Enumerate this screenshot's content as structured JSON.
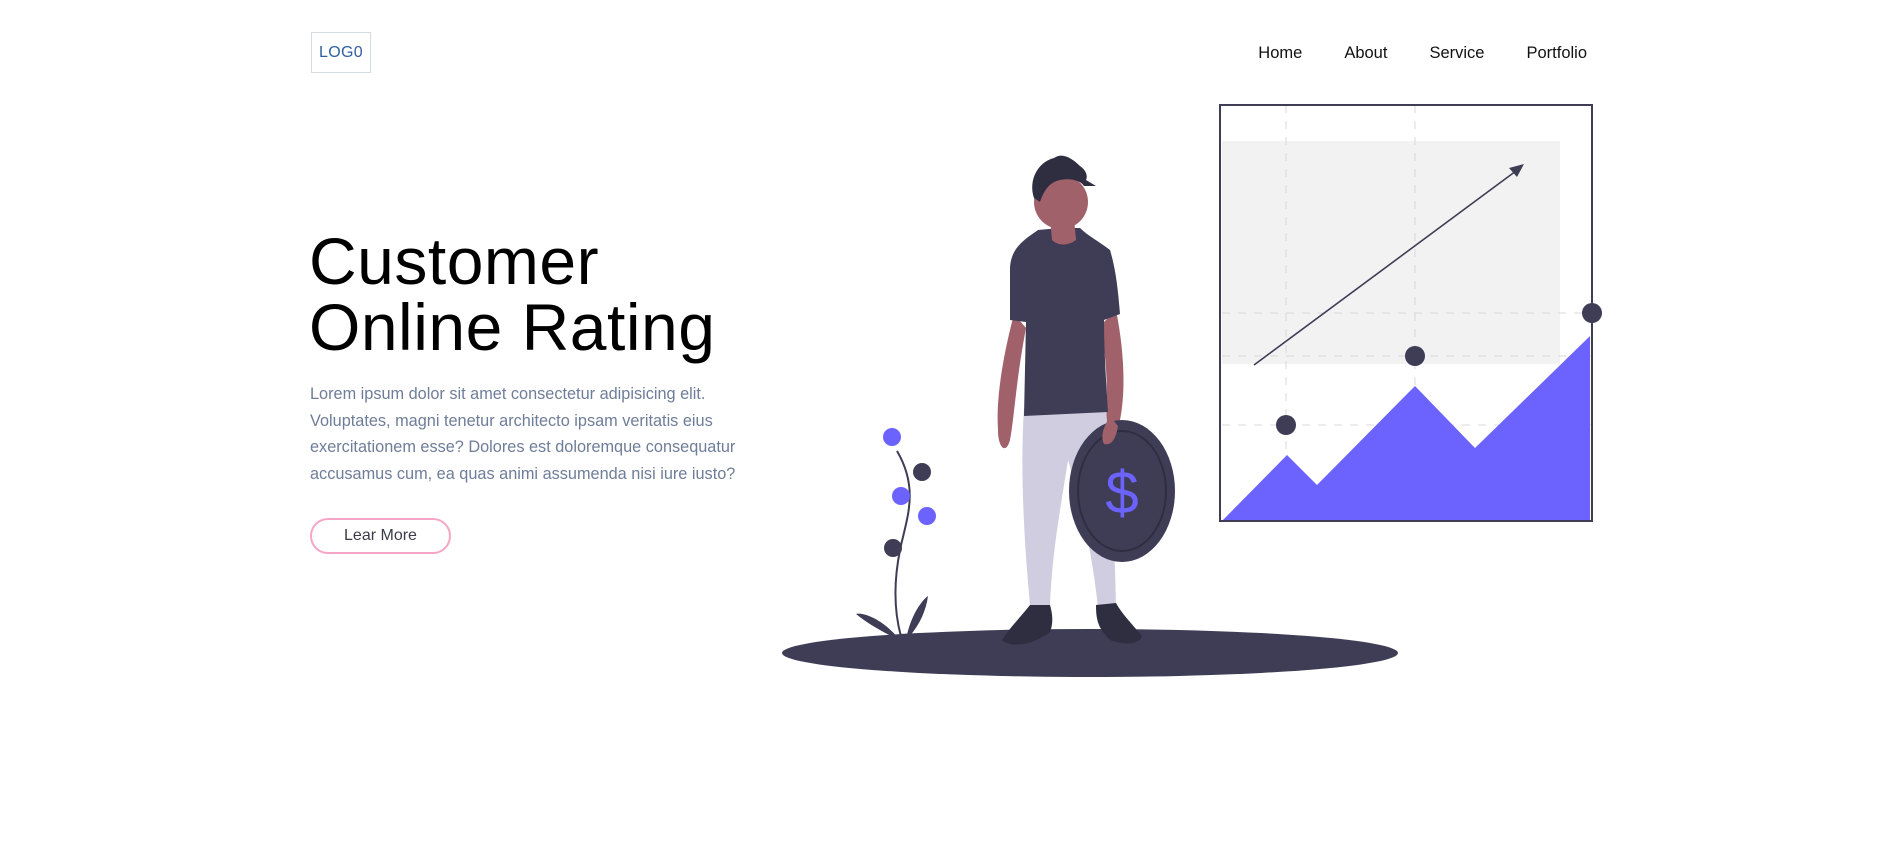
{
  "header": {
    "logo_text": "LOG0",
    "nav": [
      {
        "label": "Home"
      },
      {
        "label": "About"
      },
      {
        "label": "Service"
      },
      {
        "label": "Portfolio"
      }
    ]
  },
  "hero": {
    "title_line1": "Customer",
    "title_line2": "Online Rating",
    "description": "Lorem ipsum dolor sit amet consectetur adipisicing elit. Voluptates, magni tenetur architecto ipsam veritatis eius exercitationem esse? Dolores est doloremque consequatur accusamus cum, ea quas animi assumenda nisi iure iusto?",
    "button_label": "Lear More"
  },
  "illustration": {
    "coin_symbol": "$",
    "colors": {
      "accent": "#6c63ff",
      "dark": "#3f3d56",
      "skin": "#a0616a",
      "pants": "#d0cde1",
      "panel": "#f2f2f2",
      "button_border": "#f6a6c4"
    },
    "icons": [
      "person-figure",
      "coin-dollar-icon",
      "growth-chart",
      "flower-plant",
      "trend-arrow-icon"
    ]
  }
}
